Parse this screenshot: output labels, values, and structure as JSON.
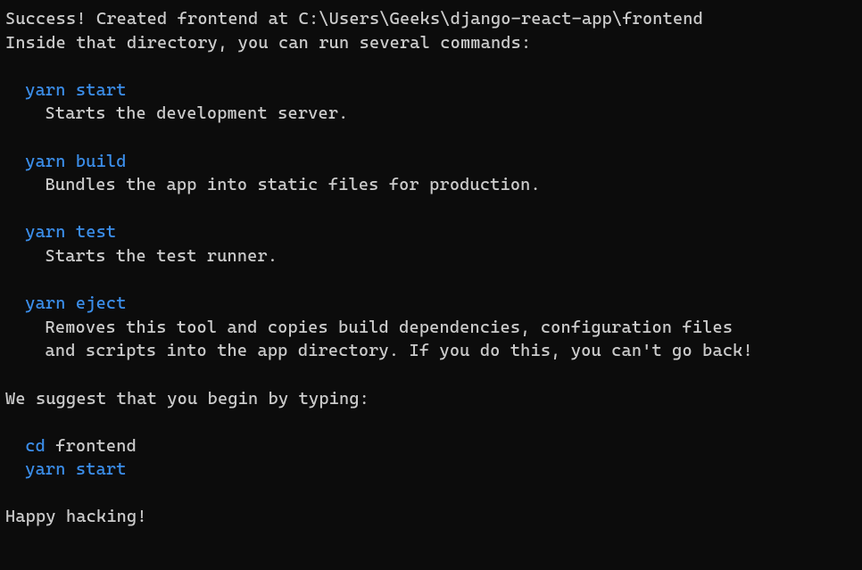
{
  "success_line": "Success! Created frontend at C:\\Users\\Geeks\\django-react-app\\frontend",
  "intro_line": "Inside that directory, you can run several commands:",
  "commands": [
    {
      "cmd": "yarn start",
      "desc": [
        "Starts the development server."
      ]
    },
    {
      "cmd": "yarn build",
      "desc": [
        "Bundles the app into static files for production."
      ]
    },
    {
      "cmd": "yarn test",
      "desc": [
        "Starts the test runner."
      ]
    },
    {
      "cmd": "yarn eject",
      "desc": [
        "Removes this tool and copies build dependencies, configuration files",
        "and scripts into the app directory. If you do this, you can't go back!"
      ]
    }
  ],
  "suggest_line": "We suggest that you begin by typing:",
  "cd": {
    "cmd": "cd",
    "arg": " frontend"
  },
  "yarn_start": "yarn start",
  "footer": "Happy hacking!"
}
